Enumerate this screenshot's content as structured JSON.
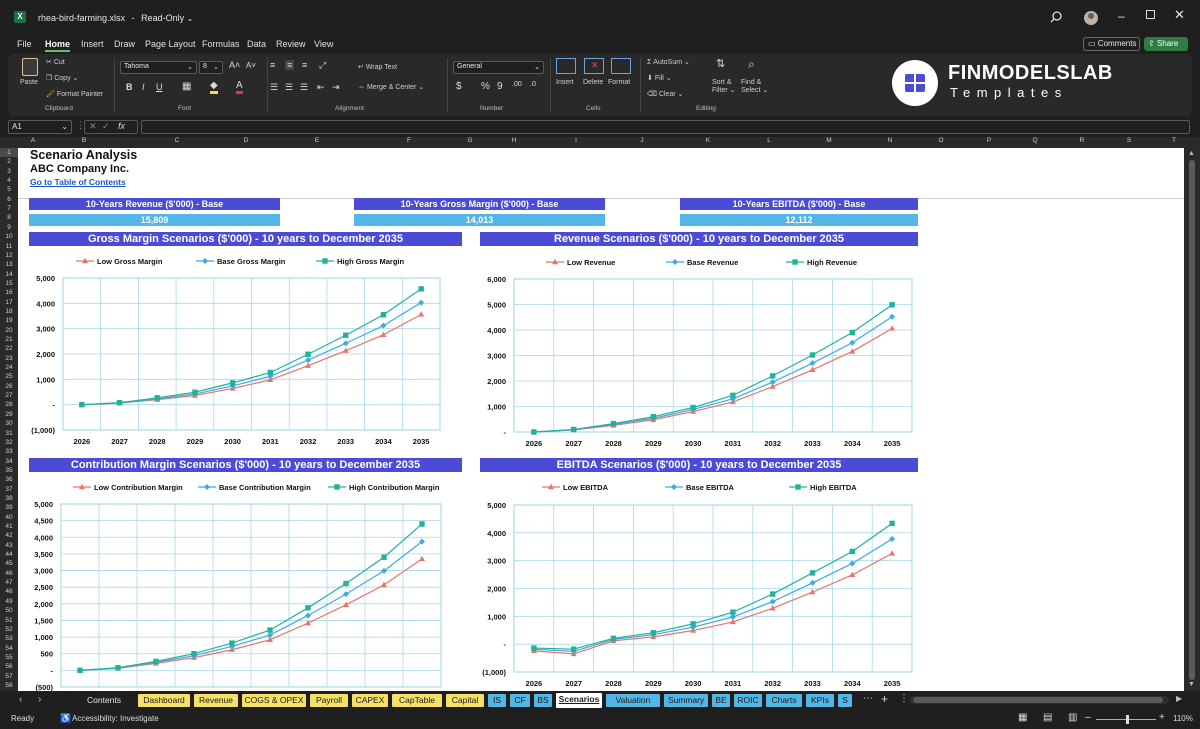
{
  "window": {
    "filename": "rhea-bird-farming.xlsx",
    "mode": "Read-Only"
  },
  "menu": [
    "File",
    "Home",
    "Insert",
    "Draw",
    "Page Layout",
    "Formulas",
    "Data",
    "Review",
    "View"
  ],
  "top_buttons": {
    "comments": "Comments",
    "share": "Share"
  },
  "ribbon": {
    "clipboard": {
      "paste": "Paste",
      "cut": "Cut",
      "copy": "Copy",
      "format_painter": "Format Painter",
      "group": "Clipboard"
    },
    "font": {
      "name": "Tahoma",
      "size": "8",
      "group": "Font"
    },
    "alignment": {
      "wrap": "Wrap Text",
      "merge": "Merge & Center",
      "group": "Alignment"
    },
    "number": {
      "format": "General",
      "group": "Number"
    },
    "cells": {
      "insert": "Insert",
      "delete": "Delete",
      "format": "Format",
      "group": "Cells"
    },
    "editing": {
      "autosum": "AutoSum",
      "fill": "Fill",
      "clear": "Clear",
      "sort": "Sort &",
      "filter": "Filter",
      "find": "Find &",
      "select": "Select",
      "group": "Editing"
    }
  },
  "logo": {
    "line1": "FINMODELSLAB",
    "line2": "Templates"
  },
  "formula_bar": {
    "name_box": "A1",
    "fx": "fx",
    "value": ""
  },
  "columns": [
    "A",
    "B",
    "C",
    "D",
    "E",
    "F",
    "G",
    "H",
    "I",
    "J",
    "K",
    "L",
    "M",
    "N",
    "O",
    "P",
    "Q",
    "R",
    "S",
    "T"
  ],
  "rows": [
    "1",
    "2",
    "3",
    "4",
    "5",
    "6",
    "7",
    "8",
    "9",
    "10",
    "11",
    "12",
    "13",
    "14",
    "15",
    "16",
    "17",
    "18",
    "19",
    "20",
    "21",
    "22",
    "23",
    "24",
    "25",
    "26",
    "27",
    "28",
    "29",
    "30",
    "31",
    "32",
    "33",
    "34",
    "35",
    "36",
    "37",
    "38",
    "39",
    "40",
    "41",
    "42",
    "43",
    "44",
    "45",
    "46",
    "47",
    "48",
    "49",
    "50",
    "51",
    "52",
    "53",
    "54",
    "55",
    "56",
    "57",
    "58"
  ],
  "sheet": {
    "title": "Scenario Analysis",
    "company": "ABC Company Inc.",
    "link": "Go to Table of Contents",
    "kpis": [
      {
        "label": "10-Years Revenue ($'000) - Base",
        "value": "15,809"
      },
      {
        "label": "10-Years Gross Margin ($'000) - Base",
        "value": "14,013"
      },
      {
        "label": "10-Years EBITDA ($'000) - Base",
        "value": "12,112"
      }
    ]
  },
  "chart_data": [
    {
      "type": "line",
      "title": "Gross Margin Scenarios ($'000) - 10 years to December 2035",
      "categories": [
        "2026",
        "2027",
        "2028",
        "2029",
        "2030",
        "2031",
        "2032",
        "2033",
        "2034",
        "2035"
      ],
      "y_ticks": [
        "5,000",
        "4,000",
        "3,000",
        "2,000",
        "1,000",
        "-",
        "(1,000)"
      ],
      "ylim": [
        -1000,
        5000
      ],
      "series": [
        {
          "name": "Low Gross Margin",
          "color": "#e8746c",
          "marker": "triangle",
          "values": [
            0,
            60,
            200,
            360,
            640,
            980,
            1540,
            2130,
            2760,
            3560
          ]
        },
        {
          "name": "Base Gross Margin",
          "color": "#3fa9e6",
          "marker": "diamond",
          "values": [
            0,
            70,
            230,
            420,
            740,
            1120,
            1760,
            2420,
            3120,
            4030
          ]
        },
        {
          "name": "High Gross Margin",
          "color": "#20b39a",
          "marker": "square",
          "values": [
            0,
            80,
            270,
            490,
            860,
            1270,
            1990,
            2740,
            3550,
            4570
          ]
        }
      ]
    },
    {
      "type": "line",
      "title": "Revenue Scenarios ($'000) - 10 years to December 2035",
      "categories": [
        "2026",
        "2027",
        "2028",
        "2029",
        "2030",
        "2031",
        "2032",
        "2033",
        "2034",
        "2035"
      ],
      "y_ticks": [
        "6,000",
        "5,000",
        "4,000",
        "3,000",
        "2,000",
        "1,000",
        "-"
      ],
      "ylim": [
        0,
        6000
      ],
      "series": [
        {
          "name": "Low Revenue",
          "color": "#e8746c",
          "marker": "triangle",
          "values": [
            0,
            80,
            260,
            480,
            800,
            1180,
            1780,
            2440,
            3160,
            4060
          ]
        },
        {
          "name": "Base Revenue",
          "color": "#3fa9e6",
          "marker": "diamond",
          "values": [
            0,
            90,
            300,
            540,
            880,
            1300,
            1960,
            2700,
            3500,
            4520
          ]
        },
        {
          "name": "High Revenue",
          "color": "#20b39a",
          "marker": "square",
          "values": [
            0,
            100,
            330,
            600,
            960,
            1440,
            2200,
            3020,
            3900,
            4990
          ]
        }
      ]
    },
    {
      "type": "line",
      "title": "Contribution Margin Scenarios ($'000) - 10 years to December 2035",
      "categories": [
        "2026",
        "2027",
        "2028",
        "2029",
        "2030",
        "2031",
        "2032",
        "2033",
        "2034",
        "2035"
      ],
      "y_ticks": [
        "5,000",
        "4,500",
        "4,000",
        "3,500",
        "3,000",
        "2,500",
        "2,000",
        "1,500",
        "1,000",
        "500",
        "-",
        "(500)"
      ],
      "ylim": [
        -500,
        5000
      ],
      "series": [
        {
          "name": "Low Contribution Margin",
          "color": "#e8746c",
          "marker": "triangle",
          "values": [
            0,
            60,
            210,
            380,
            620,
            920,
            1420,
            1970,
            2570,
            3350
          ]
        },
        {
          "name": "Base Contribution Margin",
          "color": "#3fa9e6",
          "marker": "diamond",
          "values": [
            0,
            70,
            240,
            440,
            720,
            1060,
            1650,
            2290,
            2990,
            3870
          ]
        },
        {
          "name": "High Contribution Margin",
          "color": "#20b39a",
          "marker": "square",
          "values": [
            0,
            80,
            270,
            500,
            820,
            1210,
            1880,
            2610,
            3400,
            4400
          ]
        }
      ]
    },
    {
      "type": "line",
      "title": "EBITDA Scenarios ($'000) - 10 years to December 2035",
      "categories": [
        "2026",
        "2027",
        "2028",
        "2029",
        "2030",
        "2031",
        "2032",
        "2033",
        "2034",
        "2035"
      ],
      "y_ticks": [
        "5,000",
        "4,000",
        "3,000",
        "2,000",
        "1,000",
        "-",
        "(1,000)"
      ],
      "ylim": [
        -1000,
        5000
      ],
      "series": [
        {
          "name": "Low EBITDA",
          "color": "#e8746c",
          "marker": "triangle",
          "values": [
            -240,
            -350,
            120,
            260,
            490,
            800,
            1290,
            1870,
            2490,
            3260
          ]
        },
        {
          "name": "Base EBITDA",
          "color": "#3fa9e6",
          "marker": "diamond",
          "values": [
            -180,
            -260,
            170,
            340,
            610,
            980,
            1530,
            2200,
            2900,
            3780
          ]
        },
        {
          "name": "High EBITDA",
          "color": "#20b39a",
          "marker": "square",
          "values": [
            -140,
            -180,
            210,
            410,
            730,
            1150,
            1800,
            2560,
            3330,
            4340
          ]
        }
      ]
    }
  ],
  "tabs": [
    {
      "label": "Contents",
      "bg": "#1f1f1f",
      "fg": "#e6e6e6"
    },
    {
      "label": "Dashboard",
      "bg": "#f7e06a",
      "fg": "#1a1a1a"
    },
    {
      "label": "Revenue",
      "bg": "#f7e06a",
      "fg": "#1a1a1a"
    },
    {
      "label": "COGS & OPEX",
      "bg": "#f7e06a",
      "fg": "#1a1a1a"
    },
    {
      "label": "Payroll",
      "bg": "#f7e06a",
      "fg": "#1a1a1a"
    },
    {
      "label": "CAPEX",
      "bg": "#f7e06a",
      "fg": "#1a1a1a"
    },
    {
      "label": "CapTable",
      "bg": "#f7e06a",
      "fg": "#1a1a1a"
    },
    {
      "label": "Capital",
      "bg": "#f7e06a",
      "fg": "#1a1a1a"
    },
    {
      "label": "IS",
      "bg": "#53b6e6",
      "fg": "#1a1a1a"
    },
    {
      "label": "CF",
      "bg": "#53b6e6",
      "fg": "#1a1a1a"
    },
    {
      "label": "BS",
      "bg": "#53b6e6",
      "fg": "#1a1a1a"
    },
    {
      "label": "Scenarios",
      "bg": "#ffffff",
      "fg": "#1a1a1a"
    },
    {
      "label": "Valuation",
      "bg": "#53b6e6",
      "fg": "#1a1a1a"
    },
    {
      "label": "Summary",
      "bg": "#53b6e6",
      "fg": "#1a1a1a"
    },
    {
      "label": "BE",
      "bg": "#53b6e6",
      "fg": "#1a1a1a"
    },
    {
      "label": "ROIC",
      "bg": "#53b6e6",
      "fg": "#1a1a1a"
    },
    {
      "label": "Charts",
      "bg": "#53b6e6",
      "fg": "#1a1a1a"
    },
    {
      "label": "KPIs",
      "bg": "#53b6e6",
      "fg": "#1a1a1a"
    },
    {
      "label": "S",
      "bg": "#53b6e6",
      "fg": "#1a1a1a"
    }
  ],
  "status": {
    "ready": "Ready",
    "accessibility": "Accessibility: Investigate",
    "zoom": "110%"
  }
}
